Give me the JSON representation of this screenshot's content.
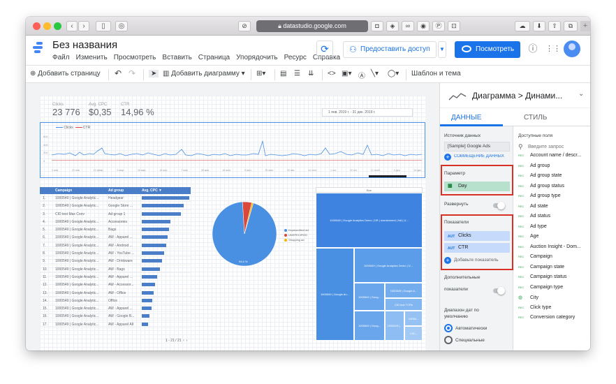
{
  "browser": {
    "url": "datastudio.google.com"
  },
  "header": {
    "title": "Без названия",
    "menu": [
      "Файл",
      "Изменить",
      "Просмотреть",
      "Вставить",
      "Страница",
      "Упорядочить",
      "Ресурс",
      "Справка"
    ],
    "share_label": "Предоставить доступ",
    "view_label": "Посмотреть"
  },
  "toolbar": {
    "add_page": "Добавить страницу",
    "add_chart": "Добавить диаграмму",
    "theme": "Шаблон и тема"
  },
  "report": {
    "kpis": [
      {
        "label": "Clicks",
        "value": "23 776"
      },
      {
        "label": "Avg. CPC",
        "value": "$0,35"
      },
      {
        "label": "CTR",
        "value": "14,96 %"
      }
    ],
    "date_range": "1 янв. 2019 г. - 31 дек. 2019 г.",
    "legend": [
      "Clicks",
      "CTR"
    ],
    "y_ticks": [
      "600",
      "400",
      "200",
      "0"
    ],
    "x_ticks": [
      "1 янв.",
      "22 янв.",
      "12 февр.",
      "5 мар.",
      "26 мар.",
      "16 апр.",
      "7 мая",
      "28 мая",
      "18 июн.",
      "9 июл.",
      "30 июл.",
      "20 авг.",
      "10 сент.",
      "1 окт.",
      "22 окт.",
      "12 нояб.",
      "3 дек.",
      "24 дек."
    ],
    "table": {
      "headers": [
        "Campaign",
        "Ad group",
        "Avg. CPC ▼"
      ],
      "rows": [
        {
          "n": "1.",
          "campaign": "1000549 | Google Analytic...",
          "adgroup": "Headgear",
          "bar": 1.0
        },
        {
          "n": "2.",
          "campaign": "1000549 | Google Analytic...",
          "adgroup": "Google Store ...",
          "bar": 0.88
        },
        {
          "n": "3.",
          "campaign": "CID test Max Conv",
          "adgroup": "Ad group 1",
          "bar": 0.82
        },
        {
          "n": "4.",
          "campaign": "1000549 | Google Analytic...",
          "adgroup": "Accessories",
          "bar": 0.6
        },
        {
          "n": "5.",
          "campaign": "1000549 | Google Analytic...",
          "adgroup": "Bags",
          "bar": 0.57
        },
        {
          "n": "6.",
          "campaign": "1000549 | Google Analytic...",
          "adgroup": "AW - Apparel ...",
          "bar": 0.55
        },
        {
          "n": "7.",
          "campaign": "1000549 | Google Analytic...",
          "adgroup": "AW - Android ...",
          "bar": 0.52
        },
        {
          "n": "8.",
          "campaign": "1000549 | Google Analytic...",
          "adgroup": "AW - YouTube ...",
          "bar": 0.47
        },
        {
          "n": "9.",
          "campaign": "1000549 | Google Analytic...",
          "adgroup": "AW - Drinkware",
          "bar": 0.43
        },
        {
          "n": "10.",
          "campaign": "1000549 | Google Analytic...",
          "adgroup": "AW - Bags",
          "bar": 0.38
        },
        {
          "n": "11.",
          "campaign": "1000549 | Google Analytic...",
          "adgroup": "AW - Apparel ...",
          "bar": 0.33
        },
        {
          "n": "12.",
          "campaign": "1000549 | Google Analytic...",
          "adgroup": "AW - Accessor...",
          "bar": 0.28
        },
        {
          "n": "13.",
          "campaign": "1000549 | Google Analytic...",
          "adgroup": "AW - Office",
          "bar": 0.25
        },
        {
          "n": "14.",
          "campaign": "1000549 | Google Analytic...",
          "adgroup": "Office",
          "bar": 0.22
        },
        {
          "n": "15.",
          "campaign": "1000549 | Google Analytic...",
          "adgroup": "AW - Apparel ...",
          "bar": 0.2
        },
        {
          "n": "16.",
          "campaign": "1000549 | Google Analytic...",
          "adgroup": "AW - Google B...",
          "bar": 0.16
        },
        {
          "n": "17.",
          "campaign": "1000549 | Google Analytic...",
          "adgroup": "AW - Apparel All",
          "bar": 0.13
        }
      ],
      "pager": "1 - 21 / 21"
    },
    "pie": {
      "slices": [
        {
          "label": "Keyword/text ad",
          "percent": 94.6,
          "color": "#4a90e2"
        },
        {
          "label": "UNSPECIFIED",
          "percent": 4.6,
          "color": "#d9483b"
        },
        {
          "label": "Shopping ad",
          "percent": 0.8,
          "color": "#f4b400"
        }
      ],
      "center_label": "94,6 %"
    },
    "treemap": {
      "header": "Все",
      "cells": [
        "1000549 | Google Analytics Demo | DR | manishmeet | NA | U...",
        "1000549 | Google Analytics Demo | D...",
        "1000549 | Google An...",
        "1000549 | Goog...",
        "1000549 | Google A...",
        "CID test TCPA",
        "1000549 | Goog...",
        "1000549 |...",
        "10054...",
        "CID..."
      ]
    }
  },
  "panel": {
    "title": "Диаграмма",
    "title_arrow": ">",
    "subtitle": "Динами...",
    "tab_data": "ДАННЫЕ",
    "tab_style": "СТИЛЬ",
    "source_label": "Источник данных",
    "source_value": "[Sample] Google Ads",
    "blend_label": "СОВМЕЩЕНИЕ ДАННЫХ",
    "dimension_label": "Параметр",
    "dimension_value": "Day",
    "expand_label": "Развернуть",
    "metrics_label": "Показатели",
    "metric_tag": "AUT",
    "metrics": [
      "Clicks",
      "CTR"
    ],
    "add_metric": "Добавьте показатель",
    "extra_metrics_label": "Дополнительные",
    "extra_metrics_label2": "показатели",
    "date_range_label": "Диапазон дат по",
    "date_range_label2": "умолчанию",
    "date_auto": "Автоматически",
    "date_custom": "Специальные",
    "fields_title": "Доступные поля",
    "search_placeholder": "Введите запрос",
    "fields": [
      "Account name / descr...",
      "Ad group",
      "Ad group state",
      "Ad group status",
      "Ad group type",
      "Ad state",
      "Ad status",
      "Ad type",
      "Age",
      "Auction Insight - Dom...",
      "Campaign",
      "Campaign state",
      "Campaign status",
      "Campaign type",
      "City",
      "Click type",
      "Conversion category"
    ]
  },
  "chart_data": {
    "type": "line",
    "series": [
      {
        "name": "Clicks",
        "color": "#4a90e2"
      },
      {
        "name": "CTR",
        "color": "#d9483b"
      }
    ],
    "ylim": [
      0,
      600
    ]
  }
}
